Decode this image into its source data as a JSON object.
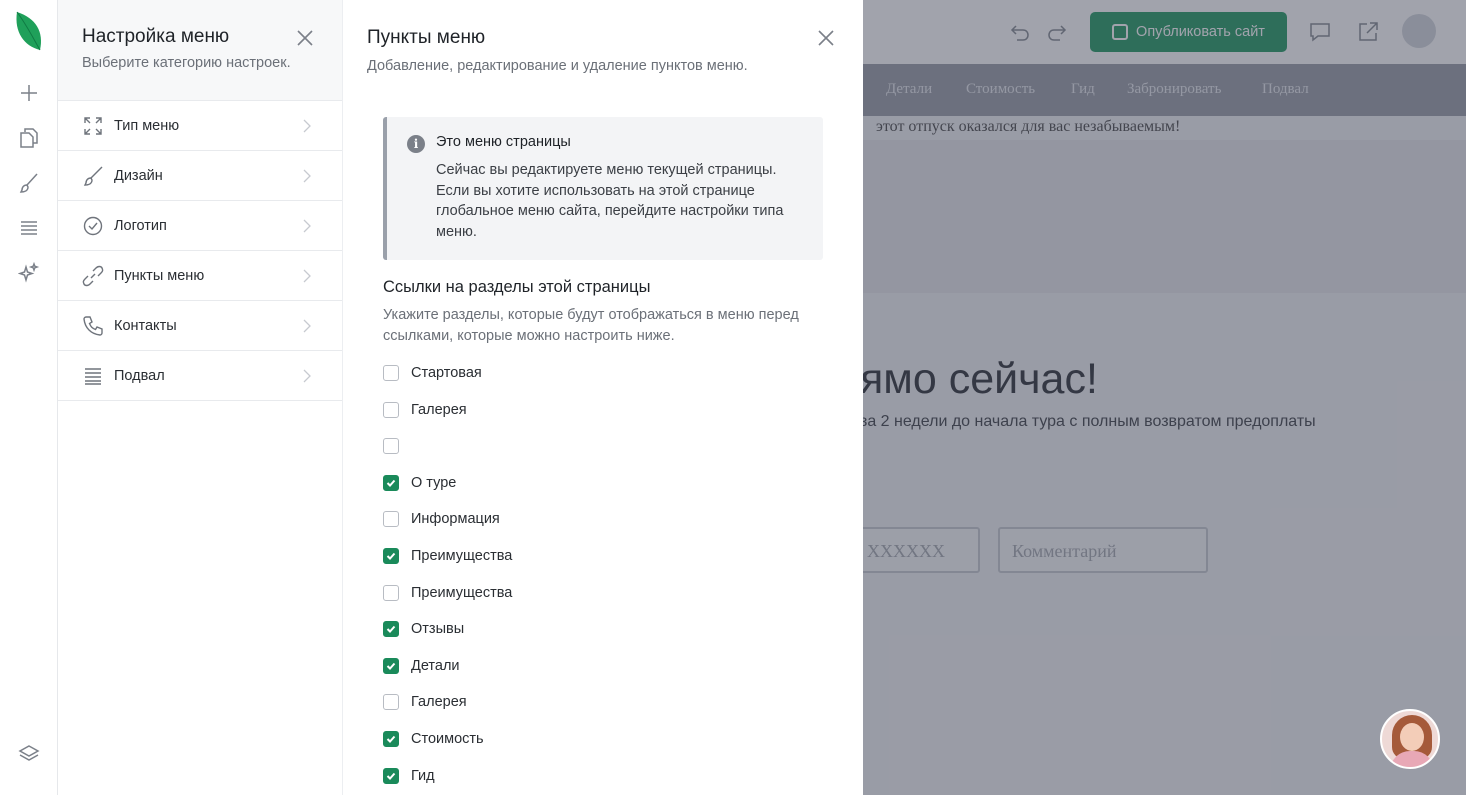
{
  "settings": {
    "title": "Настройка меню",
    "subtitle": "Выберите категорию настроек.",
    "categories": [
      {
        "label": "Тип меню",
        "icon": "expand-icon"
      },
      {
        "label": "Дизайн",
        "icon": "brush-icon"
      },
      {
        "label": "Логотип",
        "icon": "check-circle-icon"
      },
      {
        "label": "Пункты меню",
        "icon": "link-icon"
      },
      {
        "label": "Контакты",
        "icon": "phone-icon"
      },
      {
        "label": "Подвал",
        "icon": "footer-lines-icon"
      }
    ]
  },
  "menu_items": {
    "title": "Пункты меню",
    "subtitle": "Добавление, редактирование и удаление пунктов меню.",
    "notice": {
      "title": "Это меню страницы",
      "body": "Сейчас вы редактируете меню текущей страницы. Если вы хотите использовать на этой странице глобальное меню сайта, перейдите настройки типа меню."
    },
    "section_title": "Ссылки на разделы этой страницы",
    "section_subtitle": "Укажите разделы, которые будут отображаться в меню перед ссылками, которые можно настроить ниже.",
    "sections": [
      {
        "label": "Стартовая",
        "checked": false
      },
      {
        "label": "Галерея",
        "checked": false
      },
      {
        "label": "",
        "checked": false
      },
      {
        "label": "О туре",
        "checked": true
      },
      {
        "label": "Информация",
        "checked": false
      },
      {
        "label": "Преимущества",
        "checked": true
      },
      {
        "label": "Преимущества",
        "checked": false
      },
      {
        "label": "Отзывы",
        "checked": true
      },
      {
        "label": "Детали",
        "checked": true
      },
      {
        "label": "Галерея",
        "checked": false
      },
      {
        "label": "Стоимость",
        "checked": true
      },
      {
        "label": "Гид",
        "checked": true
      }
    ]
  },
  "preview": {
    "publish_label": "Опубликовать сайт",
    "nav": [
      "Детали",
      "Стоимость",
      "Гид",
      "Забронировать",
      "Подвал"
    ],
    "hero_text": "этот отпуск оказался для вас незабываемым!",
    "big_heading": "ямо сейчас!",
    "small_text": "за 2 недели до начала тура с полным возвратом предоплаты",
    "phone_field": "XXXXXX",
    "comment_placeholder": "Комментарий"
  },
  "colors": {
    "accent": "#1a8a5a",
    "publish": "#2f9e6b",
    "overlay": "#2f3446"
  }
}
